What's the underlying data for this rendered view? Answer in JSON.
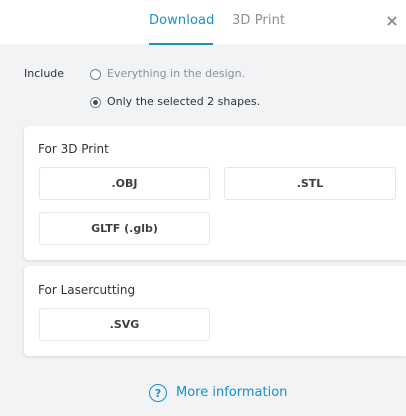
{
  "tabs": [
    {
      "label": "Download",
      "active": true
    },
    {
      "label": "3D Print",
      "active": false
    }
  ],
  "close_icon": "close-icon",
  "include": {
    "label": "Include",
    "options": [
      {
        "label": "Everything in the design.",
        "selected": false
      },
      {
        "label": "Only the selected 2 shapes.",
        "selected": true
      }
    ]
  },
  "sections": [
    {
      "title": "For 3D Print",
      "buttons": [
        ".OBJ",
        ".STL",
        "GLTF (.glb)"
      ]
    },
    {
      "title": "For Lasercutting",
      "buttons": [
        ".SVG"
      ]
    }
  ],
  "more_info": {
    "icon": "help-circle-icon",
    "glyph": "?",
    "label": "More information"
  },
  "colors": {
    "accent": "#1b8ecb",
    "background": "#f2f3f5",
    "card": "#ffffff",
    "muted_text": "#8a9098"
  }
}
